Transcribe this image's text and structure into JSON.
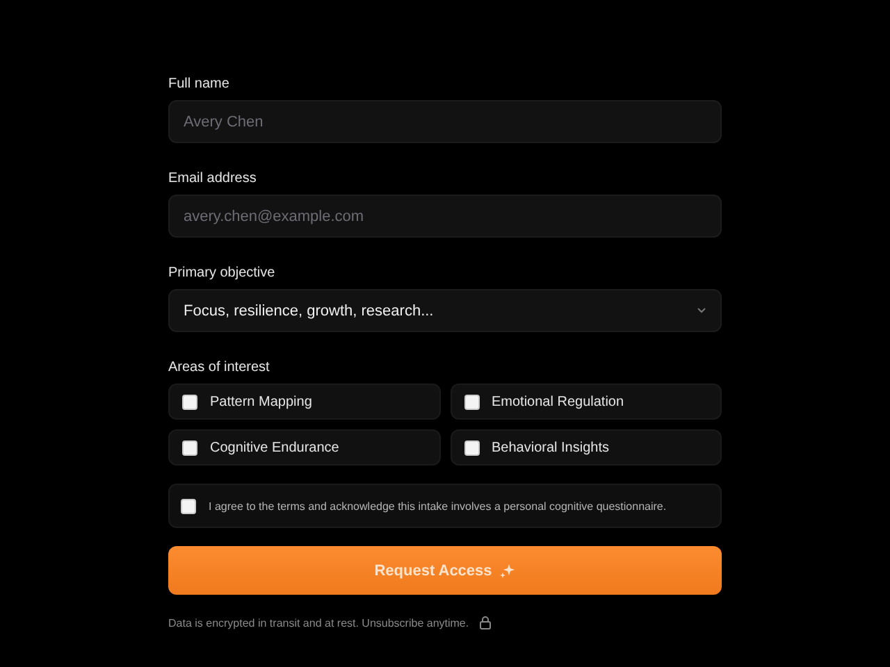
{
  "fields": [
    {
      "label": "Full name",
      "placeholder": "Avery Chen"
    },
    {
      "label": "Email address",
      "placeholder": "avery.chen@example.com"
    }
  ],
  "objective": {
    "label": "Primary objective",
    "value": "Focus, resilience, growth, research..."
  },
  "interests": {
    "label": "Areas of interest",
    "options": [
      {
        "label": "Pattern Mapping",
        "checked": false
      },
      {
        "label": "Emotional Regulation",
        "checked": false
      },
      {
        "label": "Cognitive Endurance",
        "checked": false
      },
      {
        "label": "Behavioral Insights",
        "checked": false
      }
    ]
  },
  "agreement": {
    "text": "I agree to the terms and acknowledge this intake involves a personal cognitive questionnaire.",
    "checked": false
  },
  "submit": {
    "label": "Request Access"
  },
  "footer": {
    "text": "Data is encrypted in transit and at rest. Unsubscribe anytime."
  }
}
